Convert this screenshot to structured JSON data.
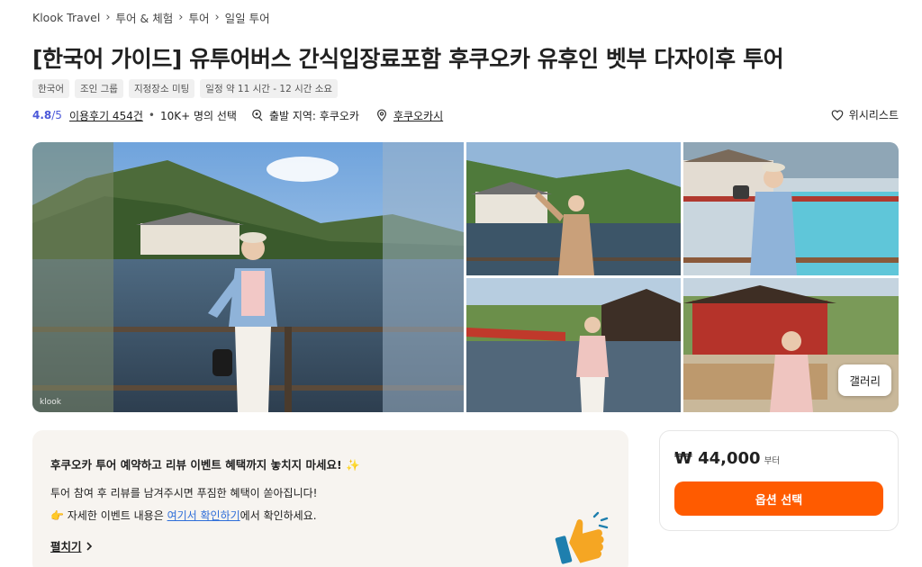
{
  "breadcrumb": [
    "Klook Travel",
    "투어 & 체험",
    "투어",
    "일일 투어"
  ],
  "title": "[한국어 가이드] 유투어버스 간식입장료포함 후쿠오카 유후인 벳부 다자이후 투어",
  "tags": [
    "한국어",
    "조인 그룹",
    "지정장소 미팅",
    "일정 약 11 시간  - 12 시간  소요"
  ],
  "meta": {
    "rating": "4.8",
    "rating_of": "/5",
    "reviews": "이용후기 454건",
    "bookings": "10K+ 명의 선택",
    "departure": "출발 지역: 후쿠오카",
    "place": "후쿠오카시",
    "wishlist": "위시리스트"
  },
  "gallery": {
    "watermark": "klook",
    "button": "갤러리"
  },
  "promo": {
    "title": "후쿠오카 투어 예약하고 리뷰 이벤트 혜택까지 놓치지 마세요! ✨",
    "line1": "투어 참여 후 리뷰를 남겨주시면 푸짐한 혜택이 쏟아집니다!",
    "line2_prefix": "👉 자세한 이벤트 내용은 ",
    "line2_link": "여기서 확인하기",
    "line2_suffix": "에서 확인하세요.",
    "expand": "펼치기"
  },
  "price": {
    "amount": "₩ 44,000",
    "suffix": "부터",
    "button": "옵션 선택"
  },
  "colors": {
    "accent": "#ff5b00",
    "rating": "#4b58d9",
    "link": "#2f6ed9",
    "promo_bg": "#f7f4f0"
  },
  "icons": [
    "heart-icon",
    "location-pin-icon",
    "departure-icon",
    "chevron-right-icon",
    "thumbs-up-icon"
  ]
}
